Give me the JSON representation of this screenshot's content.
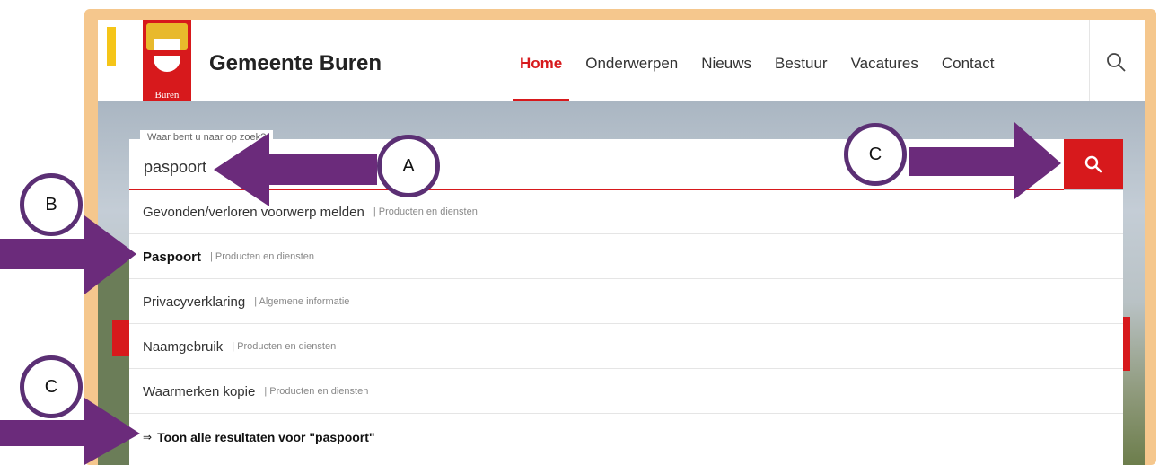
{
  "site": {
    "name": "Gemeente Buren",
    "logo_text": "Buren"
  },
  "nav": {
    "items": [
      {
        "label": "Home",
        "active": true
      },
      {
        "label": "Onderwerpen",
        "active": false
      },
      {
        "label": "Nieuws",
        "active": false
      },
      {
        "label": "Bestuur",
        "active": false
      },
      {
        "label": "Vacatures",
        "active": false
      },
      {
        "label": "Contact",
        "active": false
      }
    ]
  },
  "search": {
    "label": "Waar bent u naar op zoek?",
    "value": "paspoort"
  },
  "results": [
    {
      "title": "Gevonden/verloren voorwerp melden",
      "category": "| Producten en diensten",
      "bold": false
    },
    {
      "title": "Paspoort",
      "category": "| Producten en diensten",
      "bold": true
    },
    {
      "title": "Privacyverklaring",
      "category": "| Algemene informatie",
      "bold": false
    },
    {
      "title": "Naamgebruik",
      "category": "| Producten en diensten",
      "bold": false
    },
    {
      "title": "Waarmerken kopie",
      "category": "| Producten en diensten",
      "bold": false
    }
  ],
  "show_all": "Toon alle resultaten voor \"paspoort\"",
  "annotations": {
    "a": "A",
    "b": "B",
    "c_top": "C",
    "c_bottom": "C"
  },
  "colors": {
    "accent": "#d7191c",
    "annotation": "#6b2b7b",
    "frame": "#f5c78d"
  },
  "icons": [
    "search-icon",
    "arrow-right-icon"
  ]
}
